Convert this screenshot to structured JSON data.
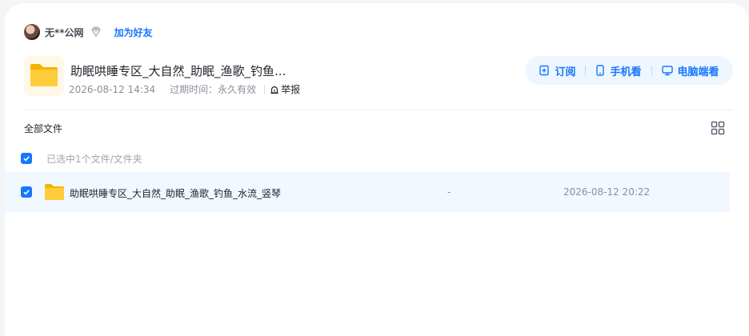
{
  "user": {
    "name": "无**公网",
    "add_friend": "加为好友"
  },
  "share": {
    "title": "助眠哄睡专区_大自然_助眠_渔歌_钓鱼...",
    "date": "2026-08-12 14:34",
    "expire_label": "过期时间：",
    "expire_value": "永久有效",
    "report": "举报"
  },
  "actions": {
    "subscribe": "订阅",
    "mobile": "手机看",
    "pc": "电脑端看"
  },
  "list": {
    "all_files": "全部文件",
    "selected_text": "已选中1个文件/文件夹",
    "rows": [
      {
        "name": "助眠哄睡专区_大自然_助眠_渔歌_钓鱼_水流_竖琴",
        "size": "-",
        "date": "2026-08-12 20:22"
      }
    ]
  },
  "colors": {
    "accent": "#1677ff",
    "folder": "#ffc93c",
    "row_selected_bg": "#f1f8ff",
    "actions_bg": "#eef7ff"
  }
}
